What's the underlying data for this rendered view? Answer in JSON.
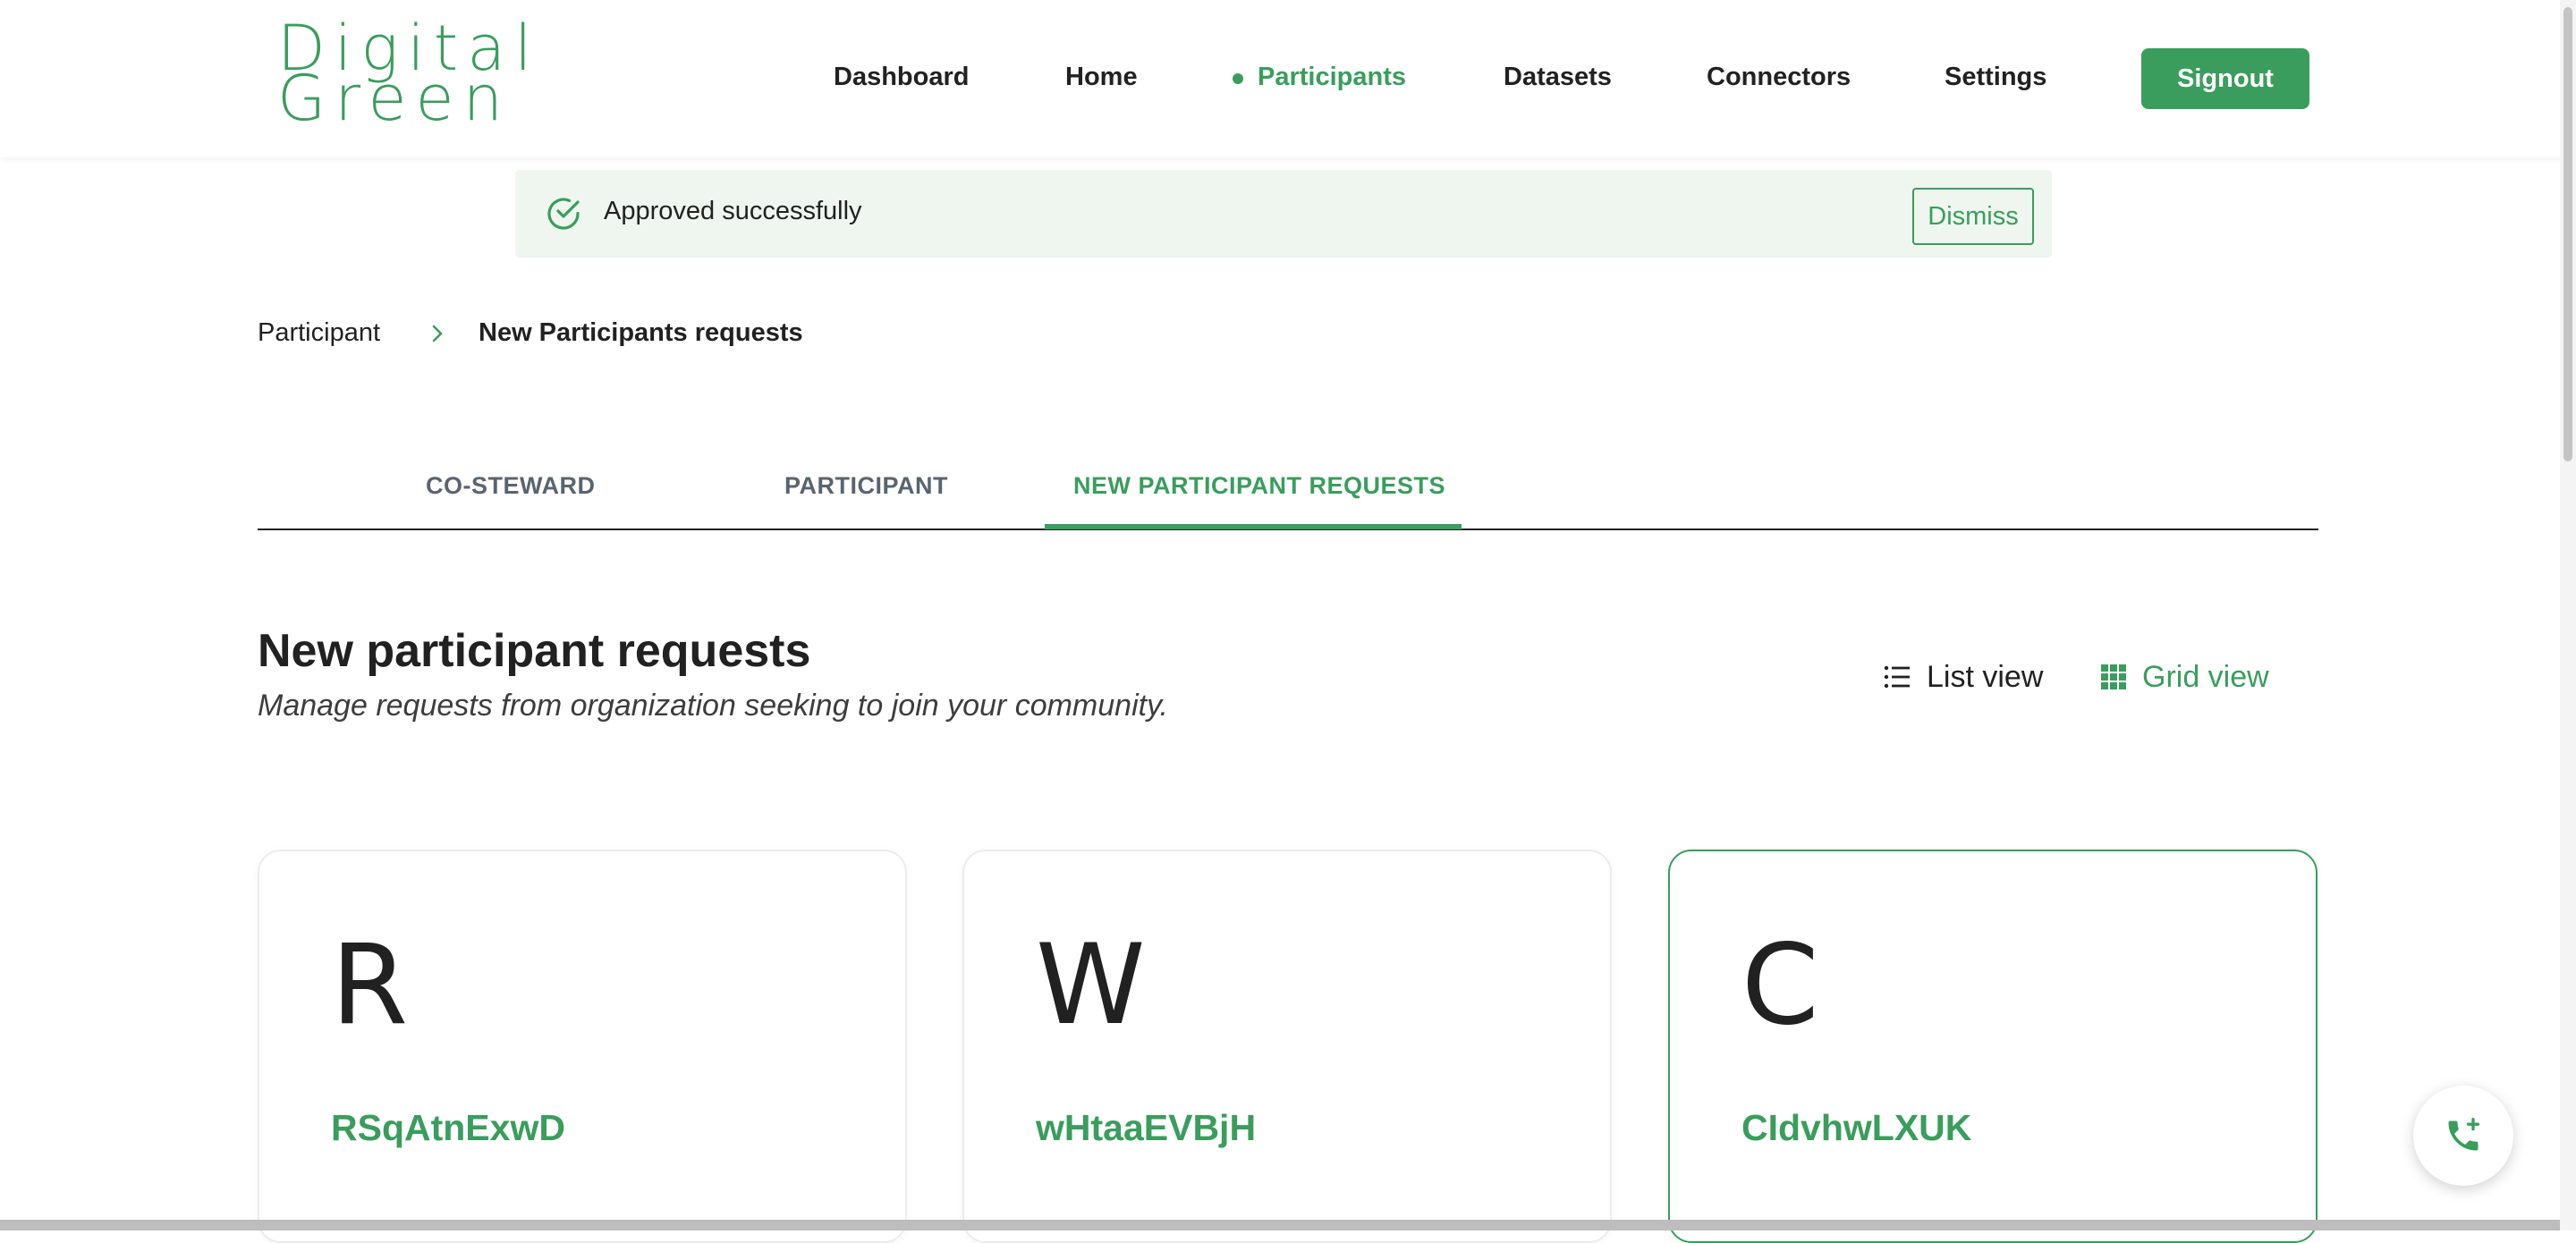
{
  "logo": {
    "line1": "Digital",
    "line2": "Green"
  },
  "nav": {
    "items": [
      {
        "label": "Dashboard",
        "active": false
      },
      {
        "label": "Home",
        "active": false
      },
      {
        "label": "Participants",
        "active": true
      },
      {
        "label": "Datasets",
        "active": false
      },
      {
        "label": "Connectors",
        "active": false
      },
      {
        "label": "Settings",
        "active": false
      }
    ],
    "signout_label": "Signout"
  },
  "alert": {
    "message": "Approved successfully",
    "dismiss_label": "Dismiss",
    "icon": "check-circle-icon"
  },
  "breadcrumb": {
    "parent": "Participant",
    "current": "New Participants requests"
  },
  "tabs": [
    {
      "label": "CO-STEWARD",
      "active": false
    },
    {
      "label": "PARTICIPANT",
      "active": false
    },
    {
      "label": "NEW PARTICIPANT REQUESTS",
      "active": true
    }
  ],
  "section": {
    "title": "New participant requests",
    "subtitle": "Manage requests from organization seeking to join your community."
  },
  "view_toggle": {
    "list_label": "List view",
    "grid_label": "Grid view",
    "selected": "grid"
  },
  "cards": [
    {
      "initial": "R",
      "name": "RSqAtnExwD",
      "selected": false
    },
    {
      "initial": "W",
      "name": "wHtaaEVBjH",
      "selected": false
    },
    {
      "initial": "C",
      "name": "CIdvhwLXUK",
      "selected": true
    }
  ],
  "fab": {
    "icon": "phone-add-icon"
  },
  "colors": {
    "accent": "#3a9d5d",
    "alert_bg": "#eef6ef",
    "text": "#212121"
  }
}
